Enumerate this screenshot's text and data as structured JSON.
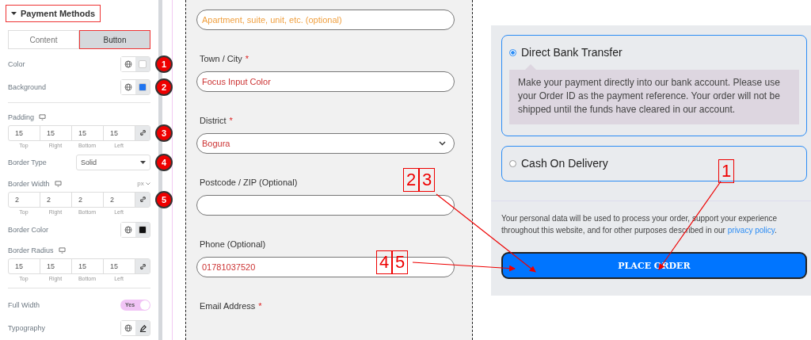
{
  "panel": {
    "title": "Payment Methods",
    "tabs": [
      {
        "label": "Content",
        "selected": false
      },
      {
        "label": "Button",
        "selected": true
      }
    ],
    "controls": [
      {
        "kind": "color",
        "label": "Color",
        "color": "#ffffff",
        "badge": "1"
      },
      {
        "kind": "color",
        "label": "Background",
        "color": "#1e73f0",
        "badge": "2"
      },
      {
        "kind": "divider"
      },
      {
        "kind": "dimensions",
        "label": "Padding",
        "values": [
          {
            "value": "15",
            "caption": "Top"
          },
          {
            "value": "15",
            "caption": "Right"
          },
          {
            "value": "15",
            "caption": "Bottom"
          },
          {
            "value": "15",
            "caption": "Left"
          }
        ],
        "badge": "3"
      },
      {
        "kind": "select",
        "label": "Border Type",
        "value": "Solid",
        "badge": "4"
      },
      {
        "kind": "dimensions",
        "label": "Border Width",
        "unit": "px",
        "values": [
          {
            "value": "2",
            "caption": "Top"
          },
          {
            "value": "2",
            "caption": "Right"
          },
          {
            "value": "2",
            "caption": "Bottom"
          },
          {
            "value": "2",
            "caption": "Left"
          }
        ],
        "badge": "5"
      },
      {
        "kind": "color",
        "label": "Border Color",
        "color": "#111111"
      },
      {
        "kind": "dimensions",
        "label": "Border Radius",
        "values": [
          {
            "value": "15",
            "caption": "Top"
          },
          {
            "value": "15",
            "caption": "Right"
          },
          {
            "value": "15",
            "caption": "Bottom"
          },
          {
            "value": "15",
            "caption": "Left"
          }
        ]
      },
      {
        "kind": "divider"
      },
      {
        "kind": "switch",
        "label": "Full Width",
        "on": true,
        "text": "Yes"
      },
      {
        "kind": "typography",
        "label": "Typography"
      }
    ]
  },
  "form": {
    "fields": [
      {
        "kind": "input",
        "placeholder": "Apartment, suite, unit, etc. (optional)"
      },
      {
        "kind": "input",
        "label": "Town / City",
        "required_mark": "*",
        "value": "Focus Input Color"
      },
      {
        "kind": "select",
        "label": "District",
        "required_mark": "*",
        "value": "Bogura"
      },
      {
        "kind": "input",
        "label": "Postcode / ZIP (Optional)"
      },
      {
        "kind": "input",
        "label": "Phone (Optional)",
        "value": "01781037520"
      },
      {
        "kind": "label",
        "label": "Email Address",
        "required_mark": "*"
      }
    ]
  },
  "payment": {
    "methods": [
      {
        "label": "Direct Bank Transfer",
        "selected": true,
        "description": "Make your payment directly into our bank account. Please use your Order ID as the payment reference. Your order will not be shipped until the funds have cleared in our account."
      },
      {
        "label": "Cash On Delivery",
        "selected": false
      }
    ],
    "privacy_text": "Your personal data will be used to process your order, support your experience throughout this website, and for other purposes described in our ",
    "privacy_link": "privacy policy",
    "privacy_end": ".",
    "button": "PLACE ORDER"
  },
  "annotations": [
    {
      "digits": [
        "2",
        "3"
      ]
    },
    {
      "digits": [
        "4",
        "5"
      ]
    },
    {
      "digits": [
        "1"
      ]
    }
  ]
}
